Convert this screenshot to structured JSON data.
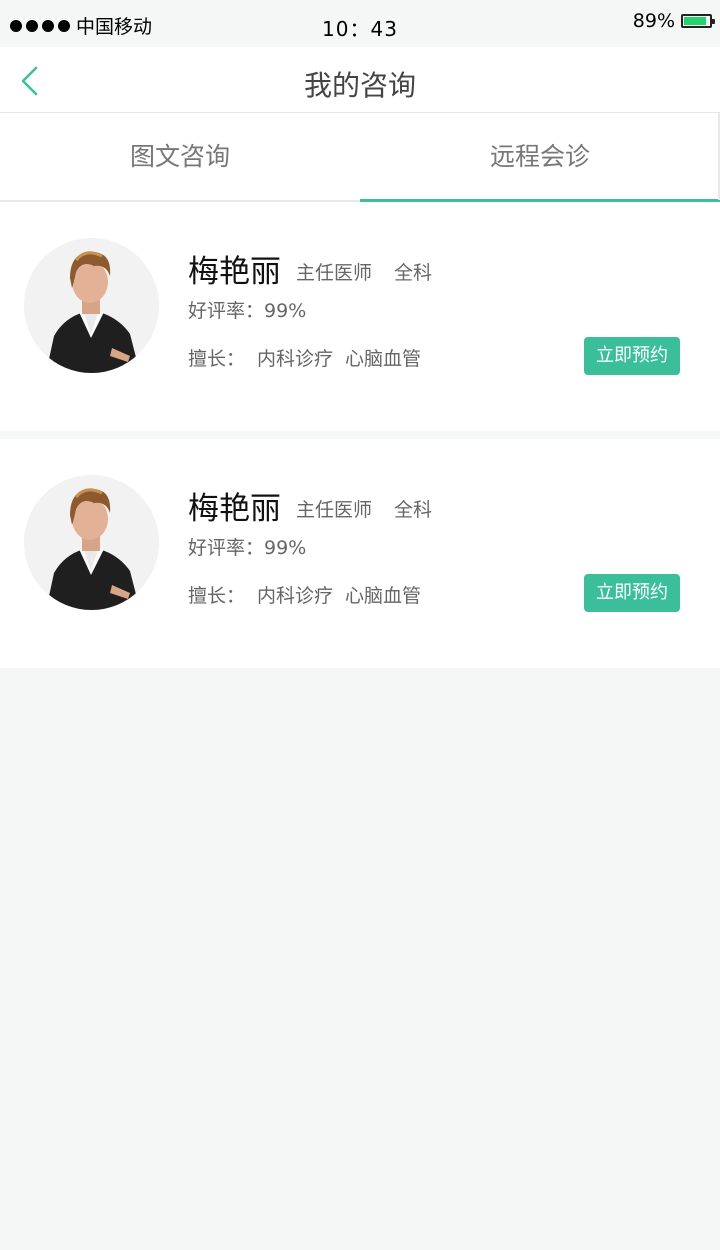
{
  "status_bar": {
    "carrier": "中国移动",
    "time": "10：43",
    "battery": "89%",
    "battery_level": 0.89,
    "signal_dots": 4
  },
  "nav": {
    "title": "我的咨询",
    "back_icon": "chevron-left-icon"
  },
  "tabs": [
    {
      "label": "图文咨询",
      "active": false
    },
    {
      "label": "远程会诊",
      "active": true
    }
  ],
  "doctors": [
    {
      "name": "梅艳丽",
      "title": "主任医师",
      "department": "全科",
      "rating_label": "好评率：",
      "rating": "99%",
      "specialty_label": "擅长：",
      "specialties": [
        "内科诊疗",
        "心脑血管"
      ],
      "button": "立即预约"
    },
    {
      "name": "梅艳丽",
      "title": "主任医师",
      "department": "全科",
      "rating_label": "好评率：",
      "rating": "99%",
      "specialty_label": "擅长：",
      "specialties": [
        "内科诊疗",
        "心脑血管"
      ],
      "button": "立即预约"
    }
  ],
  "colors": {
    "accent": "#3bbf9b",
    "background": "#f5f7f7",
    "battery": "#22d36b"
  }
}
